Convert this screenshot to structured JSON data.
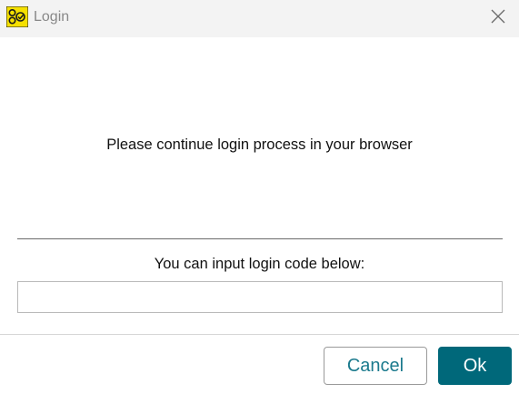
{
  "window": {
    "title": "Login",
    "app_icon": "app-logo-icon",
    "close_icon": "close-icon"
  },
  "main": {
    "message": "Please continue login process in your browser",
    "code_label": "You can input login code below:",
    "code_value": "",
    "code_placeholder": ""
  },
  "footer": {
    "cancel_label": "Cancel",
    "ok_label": "Ok"
  },
  "colors": {
    "primary": "#00687a",
    "cancel_text": "#1b7a8d",
    "titlebar": "#f3f3f3",
    "icon_yellow": "#f5e000"
  }
}
